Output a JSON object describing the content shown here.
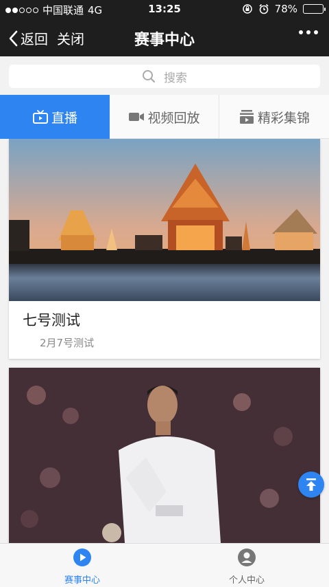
{
  "status_bar": {
    "carrier": "中国联通",
    "network": "4G",
    "time": "13:25",
    "battery": "78%",
    "battery_level": 0.78
  },
  "nav": {
    "back_label": "返回",
    "close_label": "关闭",
    "title": "赛事中心"
  },
  "search": {
    "placeholder": "搜索"
  },
  "tabs": [
    {
      "label": "直播",
      "active": true
    },
    {
      "label": "视频回放",
      "active": false
    },
    {
      "label": "精彩集锦",
      "active": false
    }
  ],
  "cards": [
    {
      "title": "七号测试",
      "subtitle": "2月7号测试"
    },
    {
      "title": "",
      "subtitle": ""
    }
  ],
  "bottom_nav": [
    {
      "label": "赛事中心",
      "active": true
    },
    {
      "label": "个人中心",
      "active": false
    }
  ],
  "colors": {
    "accent": "#2e84f0",
    "bar_dark": "#1e1e1e"
  }
}
